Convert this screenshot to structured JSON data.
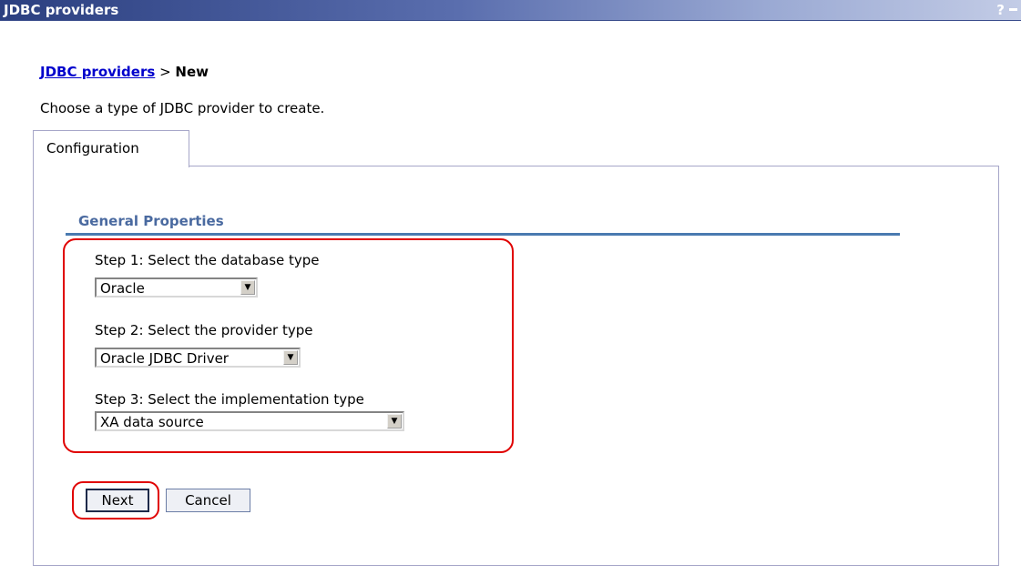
{
  "window": {
    "title": "JDBC providers",
    "help_label": "?"
  },
  "breadcrumb": {
    "link_label": "JDBC providers",
    "separator": " > ",
    "current": "New"
  },
  "intro_text": "Choose a type of JDBC provider to create.",
  "tabs": [
    {
      "label": "Configuration"
    }
  ],
  "section": {
    "title": "General Properties"
  },
  "steps": [
    {
      "label": "Step 1: Select the database type",
      "value": "Oracle"
    },
    {
      "label": "Step 2: Select the provider type",
      "value": "Oracle JDBC Driver"
    },
    {
      "label": "Step 3: Select the implementation type",
      "value": "XA data source"
    }
  ],
  "buttons": {
    "next": "Next",
    "cancel": "Cancel"
  },
  "colors": {
    "highlight": "#e00000",
    "link": "#0000cc",
    "section_title": "#4a6aa0"
  }
}
